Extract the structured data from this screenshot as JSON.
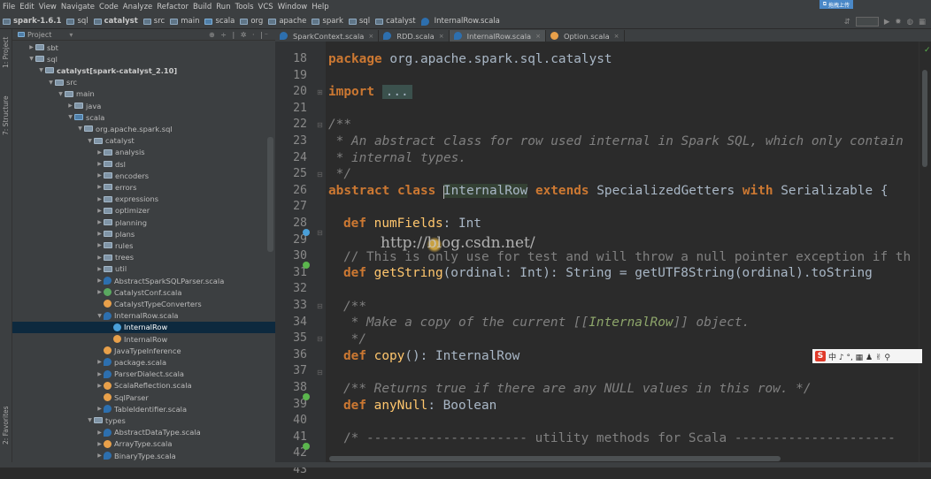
{
  "menu": [
    "File",
    "Edit",
    "View",
    "Navigate",
    "Code",
    "Analyze",
    "Refactor",
    "Build",
    "Run",
    "Tools",
    "VCS",
    "Window",
    "Help"
  ],
  "menu_upload_button": "拖拽上传",
  "breadcrumbs": [
    "spark-1.6.1",
    "sql",
    "catalyst",
    "src",
    "main",
    "scala",
    "org",
    "apache",
    "spark",
    "sql",
    "catalyst",
    "InternalRow.scala"
  ],
  "left_strip": {
    "project": "1: Project",
    "structure": "7: Structure",
    "favorites": "2: Favorites"
  },
  "project_panel": {
    "title": "Project",
    "dropdown": "▾",
    "tools": "⊕ ÷ | ✲ · |⁻"
  },
  "tree": [
    {
      "depth": 1,
      "arrow": "▶",
      "icon": "fld",
      "label": "sbt"
    },
    {
      "depth": 1,
      "arrow": "▼",
      "icon": "fld",
      "label": "sql"
    },
    {
      "depth": 2,
      "arrow": "▼",
      "icon": "fld",
      "label": "catalyst",
      "extra": " [spark-catalyst_2.10]",
      "bold": true
    },
    {
      "depth": 3,
      "arrow": "▼",
      "icon": "fld",
      "label": "src"
    },
    {
      "depth": 4,
      "arrow": "▼",
      "icon": "fld",
      "label": "main"
    },
    {
      "depth": 5,
      "arrow": "▶",
      "icon": "fld",
      "label": "java"
    },
    {
      "depth": 5,
      "arrow": "▼",
      "icon": "fldb",
      "label": "scala"
    },
    {
      "depth": 6,
      "arrow": "▼",
      "icon": "fld",
      "label": "org.apache.spark.sql"
    },
    {
      "depth": 7,
      "arrow": "▼",
      "icon": "fld",
      "label": "catalyst"
    },
    {
      "depth": 8,
      "arrow": "▶",
      "icon": "fld",
      "label": "analysis"
    },
    {
      "depth": 8,
      "arrow": "▶",
      "icon": "fld",
      "label": "dsl"
    },
    {
      "depth": 8,
      "arrow": "▶",
      "icon": "fld",
      "label": "encoders"
    },
    {
      "depth": 8,
      "arrow": "▶",
      "icon": "fld",
      "label": "errors"
    },
    {
      "depth": 8,
      "arrow": "▶",
      "icon": "fld",
      "label": "expressions"
    },
    {
      "depth": 8,
      "arrow": "▶",
      "icon": "fld",
      "label": "optimizer"
    },
    {
      "depth": 8,
      "arrow": "▶",
      "icon": "fld",
      "label": "planning"
    },
    {
      "depth": 8,
      "arrow": "▶",
      "icon": "fld",
      "label": "plans"
    },
    {
      "depth": 8,
      "arrow": "▶",
      "icon": "fld",
      "label": "rules"
    },
    {
      "depth": 8,
      "arrow": "▶",
      "icon": "fld",
      "label": "trees"
    },
    {
      "depth": 8,
      "arrow": "▶",
      "icon": "fld",
      "label": "util"
    },
    {
      "depth": 8,
      "arrow": "▶",
      "icon": "scala",
      "label": "AbstractSparkSQLParser.scala"
    },
    {
      "depth": 8,
      "arrow": "▶",
      "icon": "trt",
      "label": "CatalystConf.scala"
    },
    {
      "depth": 8,
      "arrow": "",
      "icon": "obj",
      "label": "CatalystTypeConverters"
    },
    {
      "depth": 8,
      "arrow": "▼",
      "icon": "scala",
      "label": "InternalRow.scala"
    },
    {
      "depth": 9,
      "arrow": "",
      "icon": "cls",
      "label": "InternalRow",
      "selected": true
    },
    {
      "depth": 9,
      "arrow": "",
      "icon": "obj",
      "label": "InternalRow"
    },
    {
      "depth": 8,
      "arrow": "",
      "icon": "obj",
      "label": "JavaTypeInference"
    },
    {
      "depth": 8,
      "arrow": "▶",
      "icon": "scala",
      "label": "package.scala"
    },
    {
      "depth": 8,
      "arrow": "▶",
      "icon": "scala",
      "label": "ParserDialect.scala"
    },
    {
      "depth": 8,
      "arrow": "▶",
      "icon": "obj",
      "label": "ScalaReflection.scala"
    },
    {
      "depth": 8,
      "arrow": "",
      "icon": "obj",
      "label": "SqlParser"
    },
    {
      "depth": 8,
      "arrow": "▶",
      "icon": "scala",
      "label": "TableIdentifier.scala"
    },
    {
      "depth": 7,
      "arrow": "▼",
      "icon": "fld",
      "label": "types"
    },
    {
      "depth": 8,
      "arrow": "▶",
      "icon": "scala",
      "label": "AbstractDataType.scala"
    },
    {
      "depth": 8,
      "arrow": "▶",
      "icon": "obj",
      "label": "ArrayType.scala"
    },
    {
      "depth": 8,
      "arrow": "▶",
      "icon": "scala",
      "label": "BinaryType.scala"
    }
  ],
  "tabs": [
    {
      "label": "SparkContext.scala",
      "icon": "scala",
      "active": false
    },
    {
      "label": "RDD.scala",
      "icon": "scala",
      "active": false
    },
    {
      "label": "InternalRow.scala",
      "icon": "scala",
      "active": true
    },
    {
      "label": "Option.scala",
      "icon": "obj",
      "active": false
    }
  ],
  "tab_close": "×",
  "line_numbers": [
    "18",
    "19",
    "20",
    "21",
    "22",
    "23",
    "24",
    "25",
    "26",
    "27",
    "28",
    "29",
    "30",
    "31",
    "32",
    "33",
    "34",
    "35",
    "36",
    "37",
    "38",
    "39",
    "40",
    "41",
    "42",
    "43"
  ],
  "code": {
    "l18_kw": "package",
    "l18_rest": " org.apache.spark.sql.catalyst",
    "l20_kw": "import",
    "l20_fold": "...",
    "l23": "/**",
    "l24": " * An abstract class for row used internal in Spark SQL, which only contain",
    "l25": " * internal types.",
    "l26": " */",
    "l27_kw1": "abstract class ",
    "l27_name": "InternalRow",
    "l27_kw2": " extends ",
    "l27_t1": "SpecializedGetters",
    "l27_kw3": " with ",
    "l27_t2": "Serializable {",
    "l29_kw": "def ",
    "l29_fn": "numFields",
    "l29_rest": ": Int",
    "l31": "// This is only use for test and will throw a null pointer exception if th",
    "l32_kw": "def ",
    "l32_fn": "getString",
    "l32_a": "(ordinal: Int): ",
    "l32_b": "String",
    "l32_c": " = getUTF8String(ordinal).toString",
    "l34": "/**",
    "l35a": " * Make a copy of the current [[",
    "l35b": "InternalRow",
    "l35c": "]] object.",
    "l36": " */",
    "l37_kw": "def ",
    "l37_fn": "copy",
    "l37_rest": "(): InternalRow",
    "l39": "/** Returns true if there are any NULL values in this row. */",
    "l40_kw": "def ",
    "l40_fn": "anyNull",
    "l40_rest": ": Boolean",
    "l42": "/* --------------------- utility methods for Scala ---------------------"
  },
  "watermark": "http://blog.csdn.net/",
  "ime": {
    "logo": "S",
    "text": "中 ♪ °, ▦ ♟ ✌ ⚲"
  },
  "colors": {
    "bg": "#2b2b2b",
    "keyword": "#cc7832",
    "comment": "#808080",
    "doc": "#629755",
    "selection": "#0d293e",
    "panel": "#3c3f41"
  }
}
